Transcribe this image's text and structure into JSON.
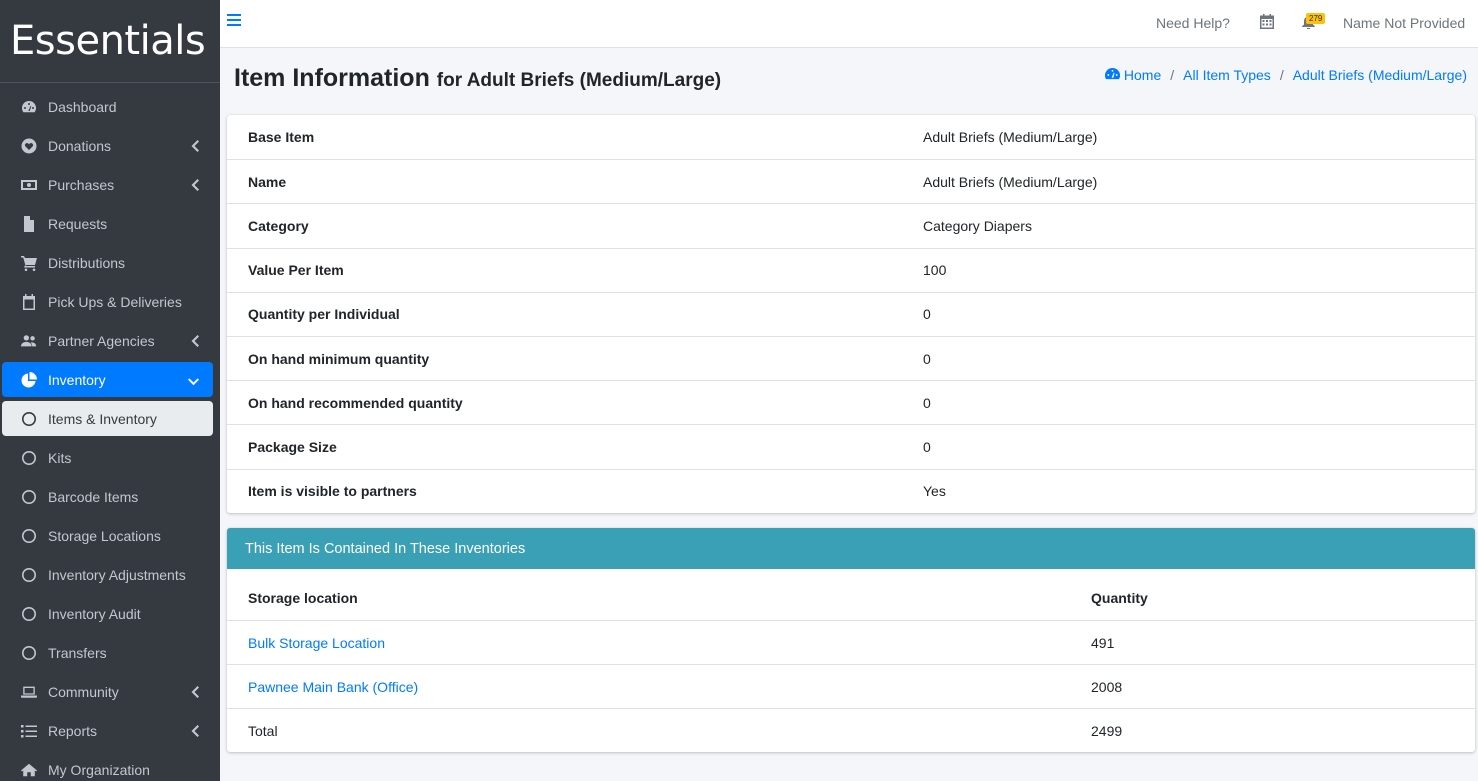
{
  "brand": "Essentials",
  "sidebar": {
    "items": [
      {
        "label": "Dashboard",
        "icon": "dashboard-icon",
        "chevron": false
      },
      {
        "label": "Donations",
        "icon": "heart-icon",
        "chevron": true
      },
      {
        "label": "Purchases",
        "icon": "money-icon",
        "chevron": true
      },
      {
        "label": "Requests",
        "icon": "file-icon",
        "chevron": false
      },
      {
        "label": "Distributions",
        "icon": "cart-icon",
        "chevron": false
      },
      {
        "label": "Pick Ups & Deliveries",
        "icon": "calendar-icon",
        "chevron": false
      },
      {
        "label": "Partner Agencies",
        "icon": "users-icon",
        "chevron": true
      },
      {
        "label": "Inventory",
        "icon": "pie-chart-icon",
        "chevron": true,
        "active": true
      },
      {
        "label": "Items & Inventory",
        "icon": "circle-icon",
        "sub_active": true
      },
      {
        "label": "Kits",
        "icon": "circle-icon"
      },
      {
        "label": "Barcode Items",
        "icon": "circle-icon"
      },
      {
        "label": "Storage Locations",
        "icon": "circle-icon"
      },
      {
        "label": "Inventory Adjustments",
        "icon": "circle-icon"
      },
      {
        "label": "Inventory Audit",
        "icon": "circle-icon"
      },
      {
        "label": "Transfers",
        "icon": "circle-icon"
      },
      {
        "label": "Community",
        "icon": "laptop-icon",
        "chevron": true
      },
      {
        "label": "Reports",
        "icon": "list-icon",
        "chevron": true
      },
      {
        "label": "My Organization",
        "icon": "house-icon",
        "chevron": false
      }
    ]
  },
  "topbar": {
    "help": "Need Help?",
    "notification_count": "279",
    "user": "Name Not Provided"
  },
  "header": {
    "title": "Item Information",
    "subtitle": "for Adult Briefs (Medium/Large)",
    "breadcrumb": [
      "Home",
      "All Item Types",
      "Adult Briefs (Medium/Large)"
    ]
  },
  "item_info": [
    {
      "label": "Base Item",
      "value": "Adult Briefs (Medium/Large)"
    },
    {
      "label": "Name",
      "value": "Adult Briefs (Medium/Large)"
    },
    {
      "label": "Category",
      "value": "Category Diapers"
    },
    {
      "label": "Value Per Item",
      "value": "100"
    },
    {
      "label": "Quantity per Individual",
      "value": "0"
    },
    {
      "label": "On hand minimum quantity",
      "value": "0"
    },
    {
      "label": "On hand recommended quantity",
      "value": "0"
    },
    {
      "label": "Package Size",
      "value": "0"
    },
    {
      "label": "Item is visible to partners",
      "value": "Yes"
    }
  ],
  "inventories": {
    "title": "This Item Is Contained In These Inventories",
    "columns": [
      "Storage location",
      "Quantity"
    ],
    "rows": [
      {
        "location": "Bulk Storage Location",
        "quantity": "491"
      },
      {
        "location": "Pawnee Main Bank (Office)",
        "quantity": "2008"
      }
    ],
    "total_label": "Total",
    "total": "2499"
  },
  "colors": {
    "sidebar_bg": "#343a40",
    "active": "#007bff",
    "card_header": "#3aa0b6",
    "link": "#007bff"
  }
}
